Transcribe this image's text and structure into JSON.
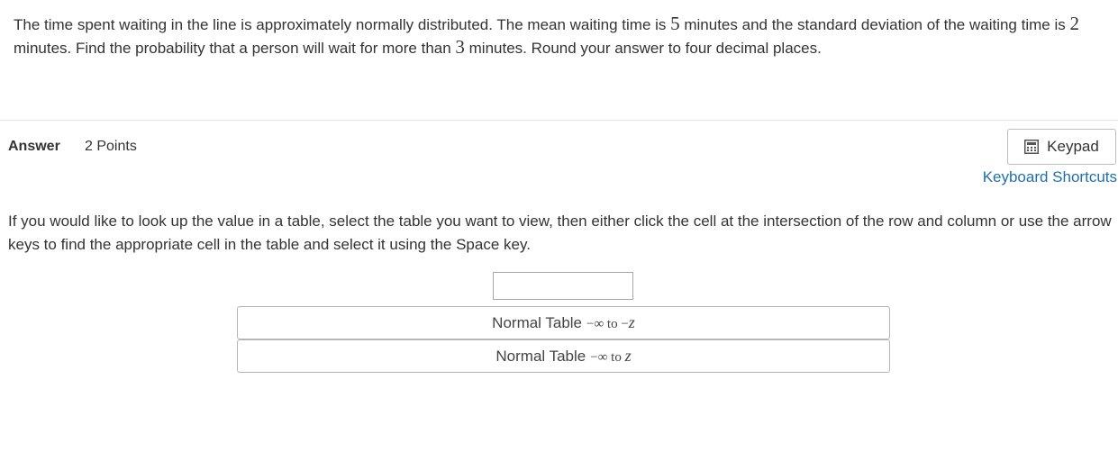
{
  "question": {
    "part1": "The time spent waiting in the line is approximately normally distributed. The mean waiting time is ",
    "mean": "5",
    "part2": " minutes and the standard deviation of the waiting time is ",
    "sd": "2",
    "part3": " minutes. Find the probability that a person will wait for more than ",
    "threshold": "3",
    "part4": " minutes. Round your answer to four decimal places."
  },
  "answer": {
    "label": "Answer",
    "points": "2 Points",
    "keypad_label": "Keypad",
    "keypad_icon": "calculator-icon",
    "keyboard_shortcuts_label": "Keyboard Shortcuts",
    "input_value": "",
    "input_placeholder": ""
  },
  "instructions": "If you would like to look up the value in a table, select the table you want to view, then either click the cell at the intersection of the row and column or use the arrow keys to find the appropriate cell in the table and select it using the Space key.",
  "tables": [
    {
      "label": "Normal Table",
      "range_prefix": "−∞ to −",
      "range_var": "z"
    },
    {
      "label": "Normal Table",
      "range_prefix": "−∞ to ",
      "range_var": "z"
    }
  ],
  "colors": {
    "link": "#1f6fb2",
    "text": "#333333",
    "border": "#b5b5b5"
  }
}
